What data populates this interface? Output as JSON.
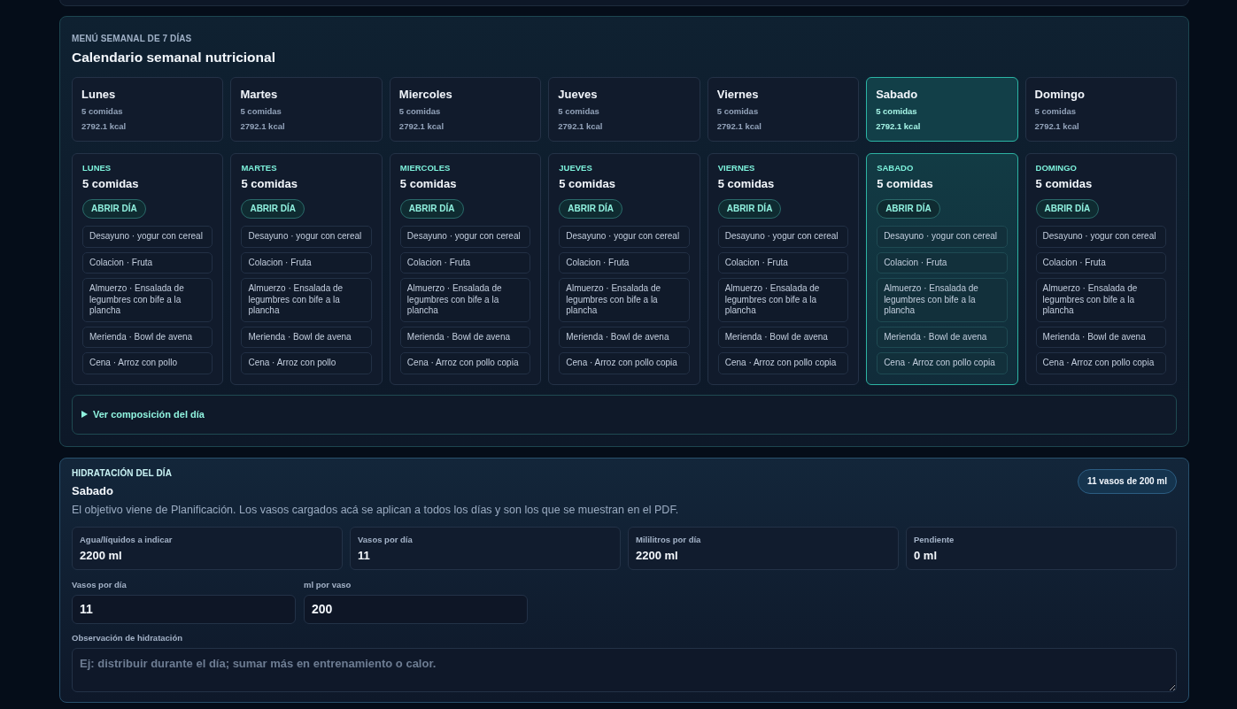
{
  "weekly_menu": {
    "eyebrow": "MENÚ SEMANAL DE 7 DÍAS",
    "title": "Calendario semanal nutricional",
    "day_tabs": [
      {
        "name": "Lunes",
        "meals": "5 comidas",
        "kcal": "2792.1 kcal",
        "selected": false
      },
      {
        "name": "Martes",
        "meals": "5 comidas",
        "kcal": "2792.1 kcal",
        "selected": false
      },
      {
        "name": "Miercoles",
        "meals": "5 comidas",
        "kcal": "2792.1 kcal",
        "selected": false
      },
      {
        "name": "Jueves",
        "meals": "5 comidas",
        "kcal": "2792.1 kcal",
        "selected": false
      },
      {
        "name": "Viernes",
        "meals": "5 comidas",
        "kcal": "2792.1 kcal",
        "selected": false
      },
      {
        "name": "Sabado",
        "meals": "5 comidas",
        "kcal": "2792.1 kcal",
        "selected": true
      },
      {
        "name": "Domingo",
        "meals": "5 comidas",
        "kcal": "2792.1 kcal",
        "selected": false
      }
    ],
    "day_cards": [
      {
        "label": "LUNES",
        "meals": "5 comidas",
        "button": "ABRIR DÍA",
        "selected": false,
        "items": [
          "Desayuno · yogur con cereal",
          "Colacion · Fruta",
          "Almuerzo · Ensalada de legumbres con bife a la plancha",
          "Merienda · Bowl de avena",
          "Cena · Arroz con pollo"
        ]
      },
      {
        "label": "MARTES",
        "meals": "5 comidas",
        "button": "ABRIR DÍA",
        "selected": false,
        "items": [
          "Desayuno · yogur con cereal",
          "Colacion · Fruta",
          "Almuerzo · Ensalada de legumbres con bife a la plancha",
          "Merienda · Bowl de avena",
          "Cena · Arroz con pollo"
        ]
      },
      {
        "label": "MIERCOLES",
        "meals": "5 comidas",
        "button": "ABRIR DÍA",
        "selected": false,
        "items": [
          "Desayuno · yogur con cereal",
          "Colacion · Fruta",
          "Almuerzo · Ensalada de legumbres con bife a la plancha",
          "Merienda · Bowl de avena",
          "Cena · Arroz con pollo copia"
        ]
      },
      {
        "label": "JUEVES",
        "meals": "5 comidas",
        "button": "ABRIR DÍA",
        "selected": false,
        "items": [
          "Desayuno · yogur con cereal",
          "Colacion · Fruta",
          "Almuerzo · Ensalada de legumbres con bife a la plancha",
          "Merienda · Bowl de avena",
          "Cena · Arroz con pollo copia"
        ]
      },
      {
        "label": "VIERNES",
        "meals": "5 comidas",
        "button": "ABRIR DÍA",
        "selected": false,
        "items": [
          "Desayuno · yogur con cereal",
          "Colacion · Fruta",
          "Almuerzo · Ensalada de legumbres con bife a la plancha",
          "Merienda · Bowl de avena",
          "Cena · Arroz con pollo copia"
        ]
      },
      {
        "label": "SABADO",
        "meals": "5 comidas",
        "button": "ABRIR DÍA",
        "selected": true,
        "items": [
          "Desayuno · yogur con cereal",
          "Colacion · Fruta",
          "Almuerzo · Ensalada de legumbres con bife a la plancha",
          "Merienda · Bowl de avena",
          "Cena · Arroz con pollo copia"
        ]
      },
      {
        "label": "DOMINGO",
        "meals": "5 comidas",
        "button": "ABRIR DÍA",
        "selected": false,
        "items": [
          "Desayuno · yogur con cereal",
          "Colacion · Fruta",
          "Almuerzo · Ensalada de legumbres con bife a la plancha",
          "Merienda · Bowl de avena",
          "Cena · Arroz con pollo copia"
        ]
      }
    ],
    "composition_toggle": {
      "label": "Ver composición del día",
      "expanded": false
    }
  },
  "hydration": {
    "eyebrow": "HIDRATACIÓN DEL DÍA",
    "day": "Sabado",
    "description": "El objetivo viene de Planificación. Los vasos cargados acá se aplican a todos los días y son los que se muestran en el PDF.",
    "badge": "11 vasos de 200 ml",
    "stats": [
      {
        "label": "Agua/líquidos a indicar",
        "value": "2200 ml"
      },
      {
        "label": "Vasos por día",
        "value": "11"
      },
      {
        "label": "Mililitros por día",
        "value": "2200 ml"
      },
      {
        "label": "Pendiente",
        "value": "0 ml"
      }
    ],
    "fields": [
      {
        "label": "Vasos por día",
        "value": "11"
      },
      {
        "label": "ml por vaso",
        "value": "200"
      }
    ],
    "notes": {
      "label": "Observación de hidratación",
      "placeholder": "Ej: distribuir durante el día; sumar más en entrenamiento o calor."
    }
  }
}
